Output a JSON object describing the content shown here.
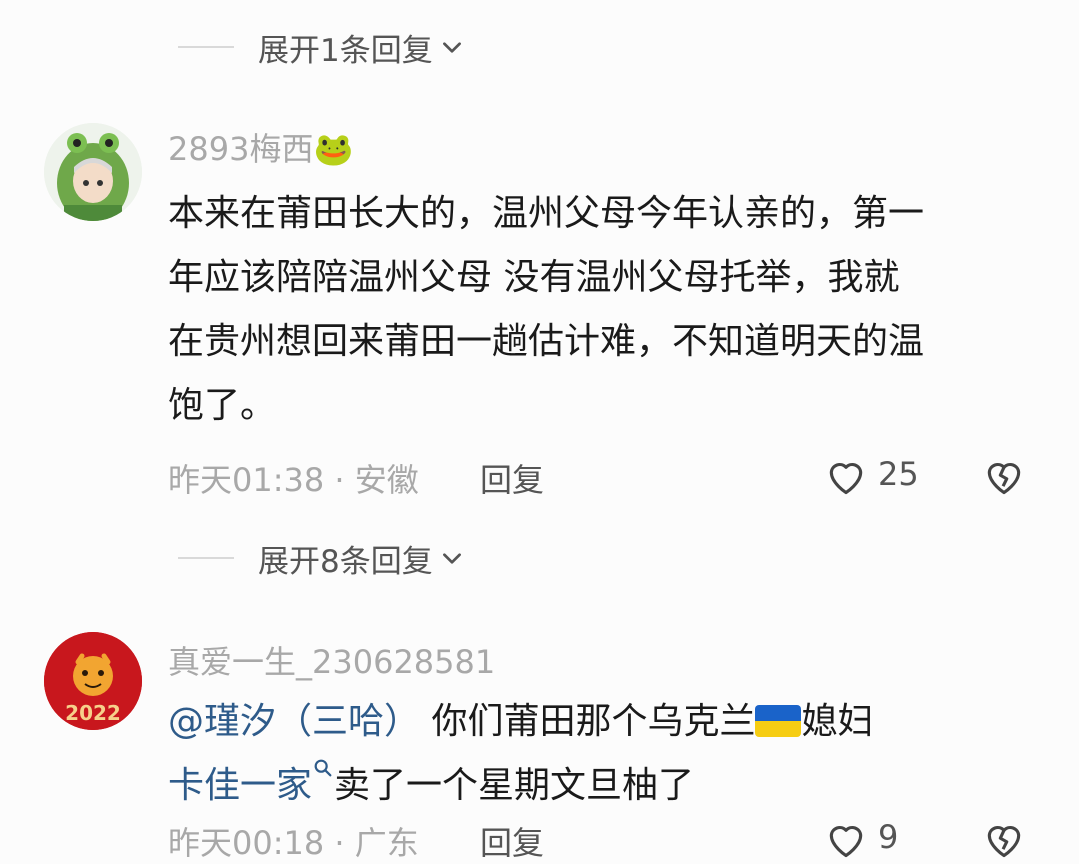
{
  "thread_top": {
    "expand_label": "展开1条回复"
  },
  "comment1": {
    "username": "2893梅西",
    "username_emoji": "🐸",
    "lines": [
      "本来在莆田长大的，温州父母今年认亲的，第一",
      "年应该陪陪温州父母 没有温州父母托举，我就",
      "在贵州想回来莆田一趟估计难，不知道明天的温",
      "饱了。"
    ],
    "time_location": "昨天01:38 · 安徽",
    "reply_label": "回复",
    "like_count": "25",
    "expand_label": "展开8条回复"
  },
  "comment2": {
    "username": "真爱一生_230628581",
    "avatar_text": "2022",
    "mention": "@瑾汐（三哈）",
    "line1_rest": " 你们莆田那个乌克兰",
    "line1_end": "媳妇",
    "link": "卡佳一家",
    "line2_rest": "卖了一个星期文旦柚了",
    "time_location": "昨天00:18 · 广东",
    "reply_label": "回复",
    "like_count": "9"
  },
  "colors": {
    "mention": "#2e5b8a",
    "meta_gray": "#a8a8a8",
    "flag_blue": "#1a63c9",
    "flag_yellow": "#f6cd13"
  },
  "icons": [
    "chevron-down-icon",
    "heart-icon",
    "broken-heart-icon",
    "frog-emoji",
    "search-icon",
    "ukraine-flag"
  ]
}
